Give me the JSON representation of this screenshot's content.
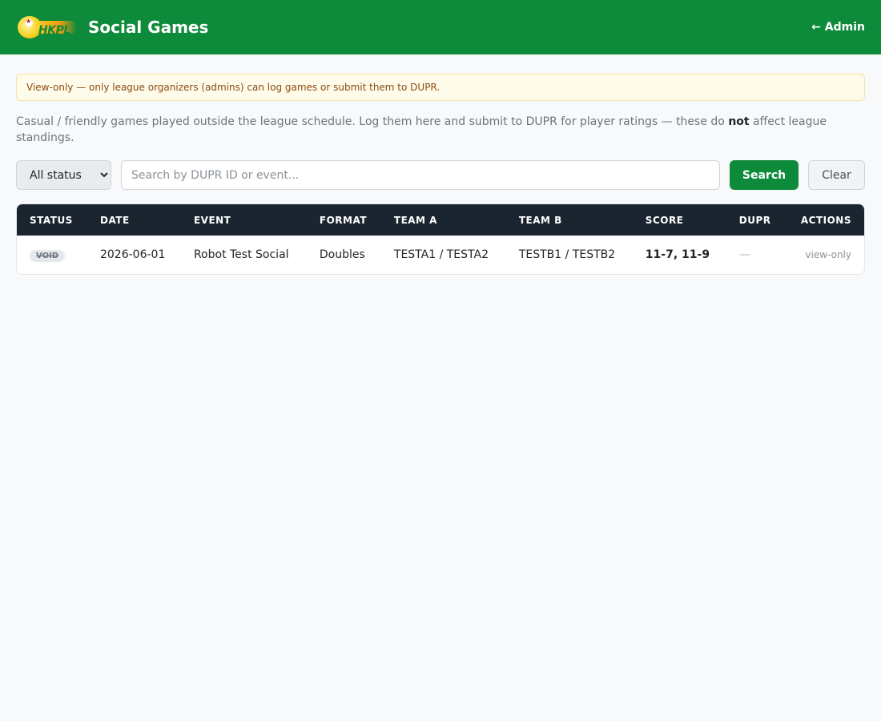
{
  "header": {
    "logo_text": "HKPL",
    "title": "Social Games",
    "admin_link": "← Admin"
  },
  "alert": {
    "text": "View-only — only league organizers (admins) can log games or submit them to DUPR."
  },
  "description": {
    "before": "Casual / friendly games played outside the league schedule. Log them here and submit to DUPR for player ratings — these do ",
    "bold": "not",
    "after": " affect league standings."
  },
  "filters": {
    "status_selected": "All status",
    "search_placeholder": "Search by DUPR ID or event...",
    "search_button": "Search",
    "clear_button": "Clear"
  },
  "table": {
    "columns": [
      "STATUS",
      "DATE",
      "EVENT",
      "FORMAT",
      "TEAM A",
      "TEAM B",
      "SCORE",
      "DUPR",
      "ACTIONS"
    ],
    "rows": [
      {
        "status": "VOID",
        "date": "2026-06-01",
        "event": "Robot Test Social",
        "format": "Doubles",
        "team_a": "TESTA1 / TESTA2",
        "team_b": "TESTB1 / TESTB2",
        "score": "11-7, 11-9",
        "dupr": "—",
        "actions": "view-only"
      }
    ]
  },
  "colors": {
    "brand_green": "#0d8a3a",
    "table_header": "#1b2530",
    "alert_bg": "#fffbea",
    "alert_text": "#8a4b0f"
  }
}
